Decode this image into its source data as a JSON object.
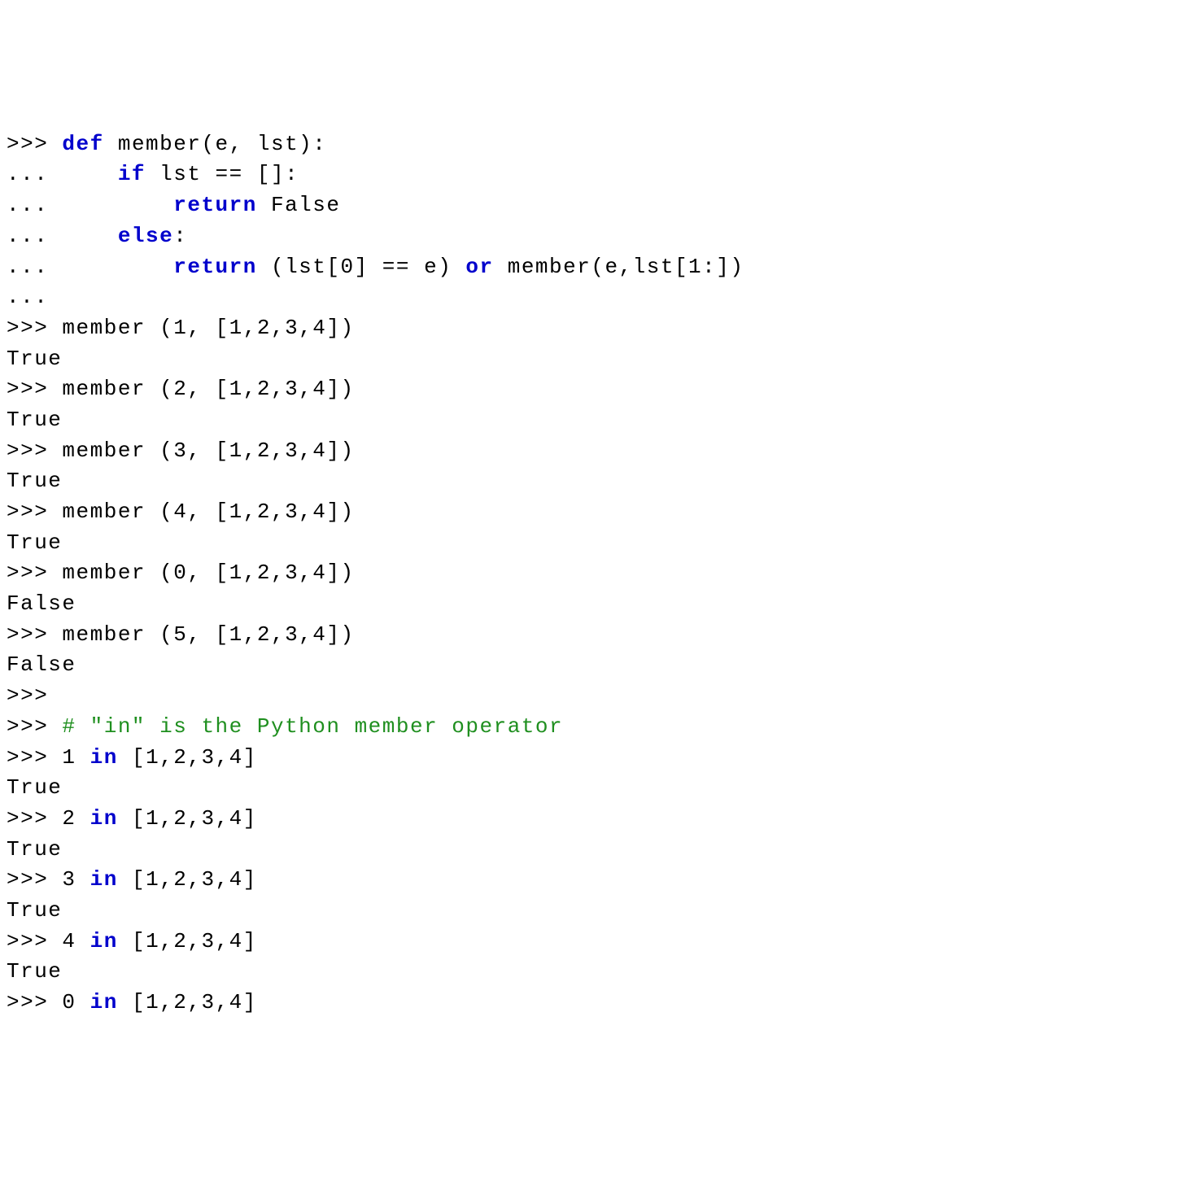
{
  "lines": [
    {
      "spans": [
        {
          "cls": "prompt",
          "t": ">>> "
        },
        {
          "cls": "kw",
          "t": "def"
        },
        {
          "cls": "plain",
          "t": " member(e, lst):"
        }
      ]
    },
    {
      "spans": [
        {
          "cls": "prompt",
          "t": "...     "
        },
        {
          "cls": "kw",
          "t": "if"
        },
        {
          "cls": "plain",
          "t": " lst == []:"
        }
      ]
    },
    {
      "spans": [
        {
          "cls": "prompt",
          "t": "...         "
        },
        {
          "cls": "kw",
          "t": "return"
        },
        {
          "cls": "plain",
          "t": " False"
        }
      ]
    },
    {
      "spans": [
        {
          "cls": "prompt",
          "t": "...     "
        },
        {
          "cls": "kw",
          "t": "else"
        },
        {
          "cls": "plain",
          "t": ":"
        }
      ]
    },
    {
      "spans": [
        {
          "cls": "prompt",
          "t": "...         "
        },
        {
          "cls": "kw",
          "t": "return"
        },
        {
          "cls": "plain",
          "t": " (lst[0] == e) "
        },
        {
          "cls": "kw",
          "t": "or"
        },
        {
          "cls": "plain",
          "t": " member(e,lst[1:])"
        }
      ]
    },
    {
      "spans": [
        {
          "cls": "prompt",
          "t": "..."
        }
      ]
    },
    {
      "spans": [
        {
          "cls": "prompt",
          "t": ">>> "
        },
        {
          "cls": "plain",
          "t": "member (1, [1,2,3,4])"
        }
      ]
    },
    {
      "spans": [
        {
          "cls": "plain",
          "t": "True"
        }
      ]
    },
    {
      "spans": [
        {
          "cls": "prompt",
          "t": ">>> "
        },
        {
          "cls": "plain",
          "t": "member (2, [1,2,3,4])"
        }
      ]
    },
    {
      "spans": [
        {
          "cls": "plain",
          "t": "True"
        }
      ]
    },
    {
      "spans": [
        {
          "cls": "prompt",
          "t": ">>> "
        },
        {
          "cls": "plain",
          "t": "member (3, [1,2,3,4])"
        }
      ]
    },
    {
      "spans": [
        {
          "cls": "plain",
          "t": "True"
        }
      ]
    },
    {
      "spans": [
        {
          "cls": "prompt",
          "t": ">>> "
        },
        {
          "cls": "plain",
          "t": "member (4, [1,2,3,4])"
        }
      ]
    },
    {
      "spans": [
        {
          "cls": "plain",
          "t": "True"
        }
      ]
    },
    {
      "spans": [
        {
          "cls": "prompt",
          "t": ">>> "
        },
        {
          "cls": "plain",
          "t": "member (0, [1,2,3,4])"
        }
      ]
    },
    {
      "spans": [
        {
          "cls": "plain",
          "t": "False"
        }
      ]
    },
    {
      "spans": [
        {
          "cls": "prompt",
          "t": ">>> "
        },
        {
          "cls": "plain",
          "t": "member (5, [1,2,3,4])"
        }
      ]
    },
    {
      "spans": [
        {
          "cls": "plain",
          "t": "False"
        }
      ]
    },
    {
      "spans": [
        {
          "cls": "prompt",
          "t": ">>>"
        }
      ]
    },
    {
      "spans": [
        {
          "cls": "prompt",
          "t": ">>> "
        },
        {
          "cls": "comment",
          "t": "# \"in\" is the Python member operator"
        }
      ]
    },
    {
      "spans": [
        {
          "cls": "prompt",
          "t": ">>> "
        },
        {
          "cls": "plain",
          "t": "1 "
        },
        {
          "cls": "kw",
          "t": "in"
        },
        {
          "cls": "plain",
          "t": " [1,2,3,4]"
        }
      ]
    },
    {
      "spans": [
        {
          "cls": "plain",
          "t": "True"
        }
      ]
    },
    {
      "spans": [
        {
          "cls": "prompt",
          "t": ">>> "
        },
        {
          "cls": "plain",
          "t": "2 "
        },
        {
          "cls": "kw",
          "t": "in"
        },
        {
          "cls": "plain",
          "t": " [1,2,3,4]"
        }
      ]
    },
    {
      "spans": [
        {
          "cls": "plain",
          "t": "True"
        }
      ]
    },
    {
      "spans": [
        {
          "cls": "prompt",
          "t": ">>> "
        },
        {
          "cls": "plain",
          "t": "3 "
        },
        {
          "cls": "kw",
          "t": "in"
        },
        {
          "cls": "plain",
          "t": " [1,2,3,4]"
        }
      ]
    },
    {
      "spans": [
        {
          "cls": "plain",
          "t": "True"
        }
      ]
    },
    {
      "spans": [
        {
          "cls": "prompt",
          "t": ">>> "
        },
        {
          "cls": "plain",
          "t": "4 "
        },
        {
          "cls": "kw",
          "t": "in"
        },
        {
          "cls": "plain",
          "t": " [1,2,3,4]"
        }
      ]
    },
    {
      "spans": [
        {
          "cls": "plain",
          "t": "True"
        }
      ]
    },
    {
      "spans": [
        {
          "cls": "prompt",
          "t": ">>> "
        },
        {
          "cls": "plain",
          "t": "0 "
        },
        {
          "cls": "kw",
          "t": "in"
        },
        {
          "cls": "plain",
          "t": " [1,2,3,4]"
        }
      ]
    }
  ]
}
